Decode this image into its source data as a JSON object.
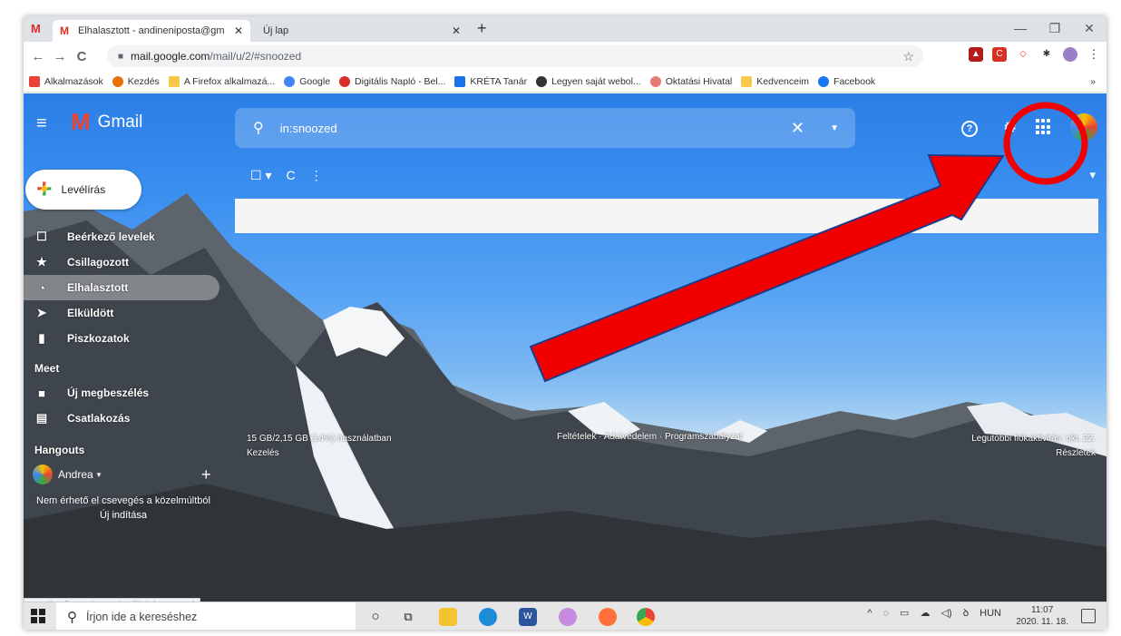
{
  "browser": {
    "tabs": [
      {
        "label": "Elhalasztott - andineniposta@gm",
        "close": "✕"
      },
      {
        "label": "Új lap",
        "close": "✕"
      }
    ],
    "new_tab": "+",
    "window_controls": {
      "minimize": "—",
      "restore": "❐",
      "close": "✕"
    },
    "nav": {
      "back": "←",
      "forward": "→",
      "reload": "C"
    },
    "address": {
      "host": "mail.google.com",
      "path": "/mail/u/2/#snoozed"
    },
    "bookmark_star": "☆",
    "menu": "⋮",
    "bookmarks": [
      {
        "label": "Alkalmazások",
        "color": "#e94335"
      },
      {
        "label": "Kezdés",
        "color": "#e8710a"
      },
      {
        "label": "A Firefox alkalmazá...",
        "color": "#f7c948"
      },
      {
        "label": "Google",
        "color": "#4285f4"
      },
      {
        "label": "Digitális Napló - Bel...",
        "color": "#d93025"
      },
      {
        "label": "KRÉTA Tanár",
        "color": "#1a73e8"
      },
      {
        "label": "Legyen saját webol...",
        "color": "#333333"
      },
      {
        "label": "Oktatási Hivatal",
        "color": "#e67c73"
      },
      {
        "label": "Kedvenceim",
        "color": "#f7c948"
      },
      {
        "label": "Facebook",
        "color": "#1877f2"
      }
    ],
    "bookmarks_more": "»"
  },
  "gmail": {
    "menu_icon": "≡",
    "logo_letter": "M",
    "logo_text": "Gmail",
    "search_query": "in:snoozed",
    "search_clear": "✕",
    "search_dropdown": "▼",
    "help": "?",
    "settings": "⚙",
    "compose_label": "Levélírás",
    "compose_plus": "+",
    "toolbar": {
      "select": "☐ ▾",
      "refresh": "C",
      "more": "⋮"
    },
    "toolbar_right": "▾",
    "nav_items": [
      {
        "label": "Beérkező levelek",
        "icon": "☐"
      },
      {
        "label": "Csillagozott",
        "icon": "★"
      },
      {
        "label": "Elhalasztott",
        "icon": "◔"
      },
      {
        "label": "Elküldött",
        "icon": "➤"
      },
      {
        "label": "Piszkozatok",
        "icon": "▮"
      }
    ],
    "meet_title": "Meet",
    "meet_items": [
      {
        "label": "Új megbeszélés",
        "icon": "■"
      },
      {
        "label": "Csatlakozás",
        "icon": "▤"
      }
    ],
    "hangouts_title": "Hangouts",
    "hangouts_user": "Andrea",
    "hangouts_user_caret": "▾",
    "hangouts_add": "+",
    "no_chats": "Nem érhető el csevegés a közelmúltból",
    "start_chat": "Új indítása",
    "storage": "15 GB/2,15 GB (14%) használatban",
    "manage": "Kezelés",
    "footer_links": "Feltételek · Adatvédelem · Programszabályzat",
    "last_activity_1": "Legutóbbi fiókaktivitás: okt. 22.",
    "last_activity_2": "Részletek"
  },
  "status_url": "ttps://mail.google.com/mail/u/2/#snoozed",
  "taskbar": {
    "search_placeholder": "Írjon ide a kereséshez",
    "language": "HUN",
    "time": "11:07",
    "date": "2020. 11. 18.",
    "tray_icons": [
      "^",
      "◌",
      "▭",
      "☁",
      "◁)",
      "ꝺ"
    ]
  },
  "colors": {
    "gmail_header": "#2a7ee6",
    "annotation_red": "#f20000",
    "taskbar": "#e6e6e6"
  }
}
